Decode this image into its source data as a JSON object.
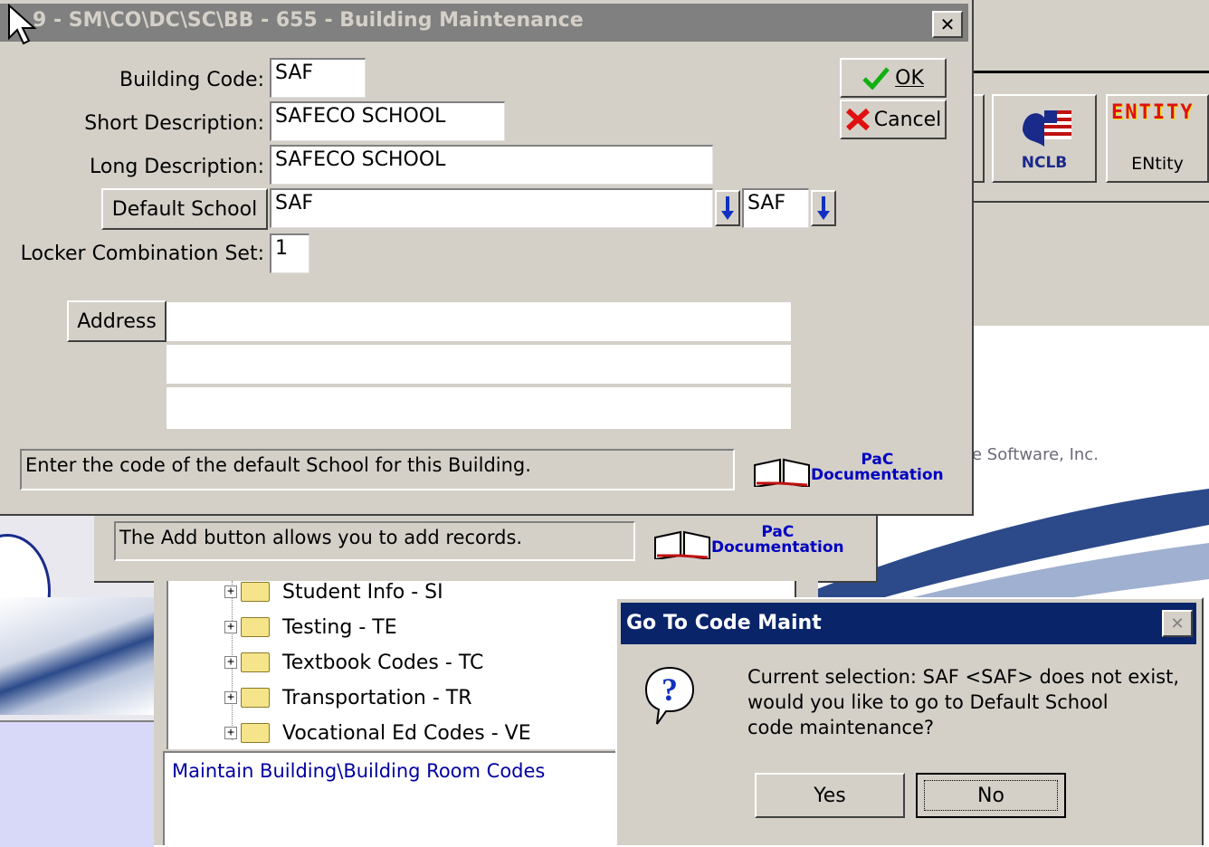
{
  "background": {
    "toolbar_buttons": [
      {
        "label": "NCLB"
      },
      {
        "label": "ENtity",
        "logo_text": "ENTITY"
      }
    ],
    "company_text": "e Software, Inc.",
    "under_dialog": {
      "status_text": "The Add button allows you to add records.",
      "doc_link_line1": "PaC",
      "doc_link_line2": "Documentation"
    },
    "tree": {
      "items": [
        {
          "label": "Student Info - SI"
        },
        {
          "label": "Testing - TE"
        },
        {
          "label": "Textbook Codes - TC"
        },
        {
          "label": "Transportation - TR"
        },
        {
          "label": "Vocational Ed Codes - VE"
        }
      ],
      "footer_text": "Maintain Building\\Building Room Codes"
    }
  },
  "main_dialog": {
    "title": "9 - SM\\CO\\DC\\SC\\BB - 655 - Building Maintenance",
    "close_glyph": "✕",
    "building_code_label": "Building Code:",
    "building_code_value": "SAF",
    "short_desc_label": "Short Description:",
    "short_desc_value": "SAFECO SCHOOL",
    "long_desc_label": "Long Description:",
    "long_desc_value": "SAFECO SCHOOL",
    "default_school_button": "Default School",
    "default_school_value": "SAF",
    "default_school_code": "SAF",
    "locker_label": "Locker Combination Set:",
    "locker_value": "1",
    "address_button": "Address",
    "address_lines": [
      "",
      "",
      ""
    ],
    "ok_label": "OK",
    "cancel_label": "Cancel",
    "status_text": "Enter the code of the default School for this Building.",
    "doc_link_line1": "PaC",
    "doc_link_line2": "Documentation"
  },
  "confirm_dialog": {
    "title": "Go To Code Maint",
    "message_line1": "Current selection: SAF <SAF> does not exist,",
    "message_line2": "would you like to go to  Default School",
    "message_line3": "code maintenance?",
    "yes_label": "Yes",
    "no_label": "No"
  },
  "colors": {
    "title_inactive": "#808080",
    "title_active": "#0a246a",
    "face": "#d4d0c8",
    "link": "#0000c0"
  }
}
